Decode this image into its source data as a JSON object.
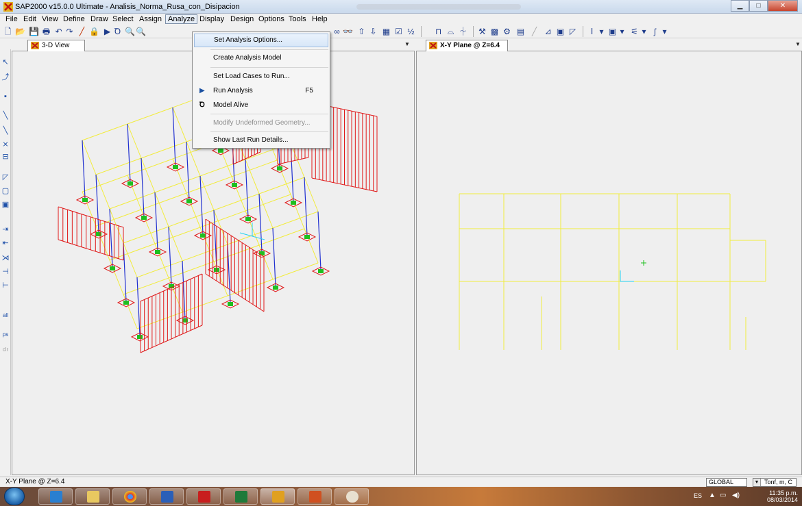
{
  "window": {
    "title": "SAP2000 v15.0.0 Ultimate  - Analisis_Norma_Rusa_con_Disipacion",
    "controls": [
      "minimize",
      "maximize",
      "close"
    ]
  },
  "menubar": {
    "items": [
      "File",
      "Edit",
      "View",
      "Define",
      "Draw",
      "Select",
      "Assign",
      "Analyze",
      "Display",
      "Design",
      "Options",
      "Tools",
      "Help"
    ],
    "active": "Analyze"
  },
  "analyze_menu": {
    "items": [
      {
        "label": "Set Analysis Options...",
        "highlighted": true
      },
      {
        "label": "Create Analysis Model"
      },
      {
        "label": "Set Load Cases to Run..."
      },
      {
        "label": "Run Analysis",
        "shortcut": "F5",
        "icon": "play-icon"
      },
      {
        "label": "Model Alive",
        "icon": "model-alive-icon"
      },
      {
        "label": "Modify Undeformed Geometry...",
        "disabled": true
      },
      {
        "label": "Show Last Run Details..."
      }
    ]
  },
  "views": {
    "left_tab": "3-D View",
    "right_tab": "X-Y Plane @ Z=6.4"
  },
  "statusbar": {
    "text": "X-Y Plane @ Z=6.4",
    "coord_system": "GLOBAL",
    "units": "Tonf, m, C"
  },
  "taskbar": {
    "language": "ES",
    "time": "11:35 p.m.",
    "date": "08/03/2014"
  },
  "colors": {
    "frame_lines": "#f2ec3c",
    "columns": "#2030d0",
    "walls_dampers": "#e01818",
    "supports": "#1fbf1f",
    "axes_cyan": "#20d0f0"
  }
}
